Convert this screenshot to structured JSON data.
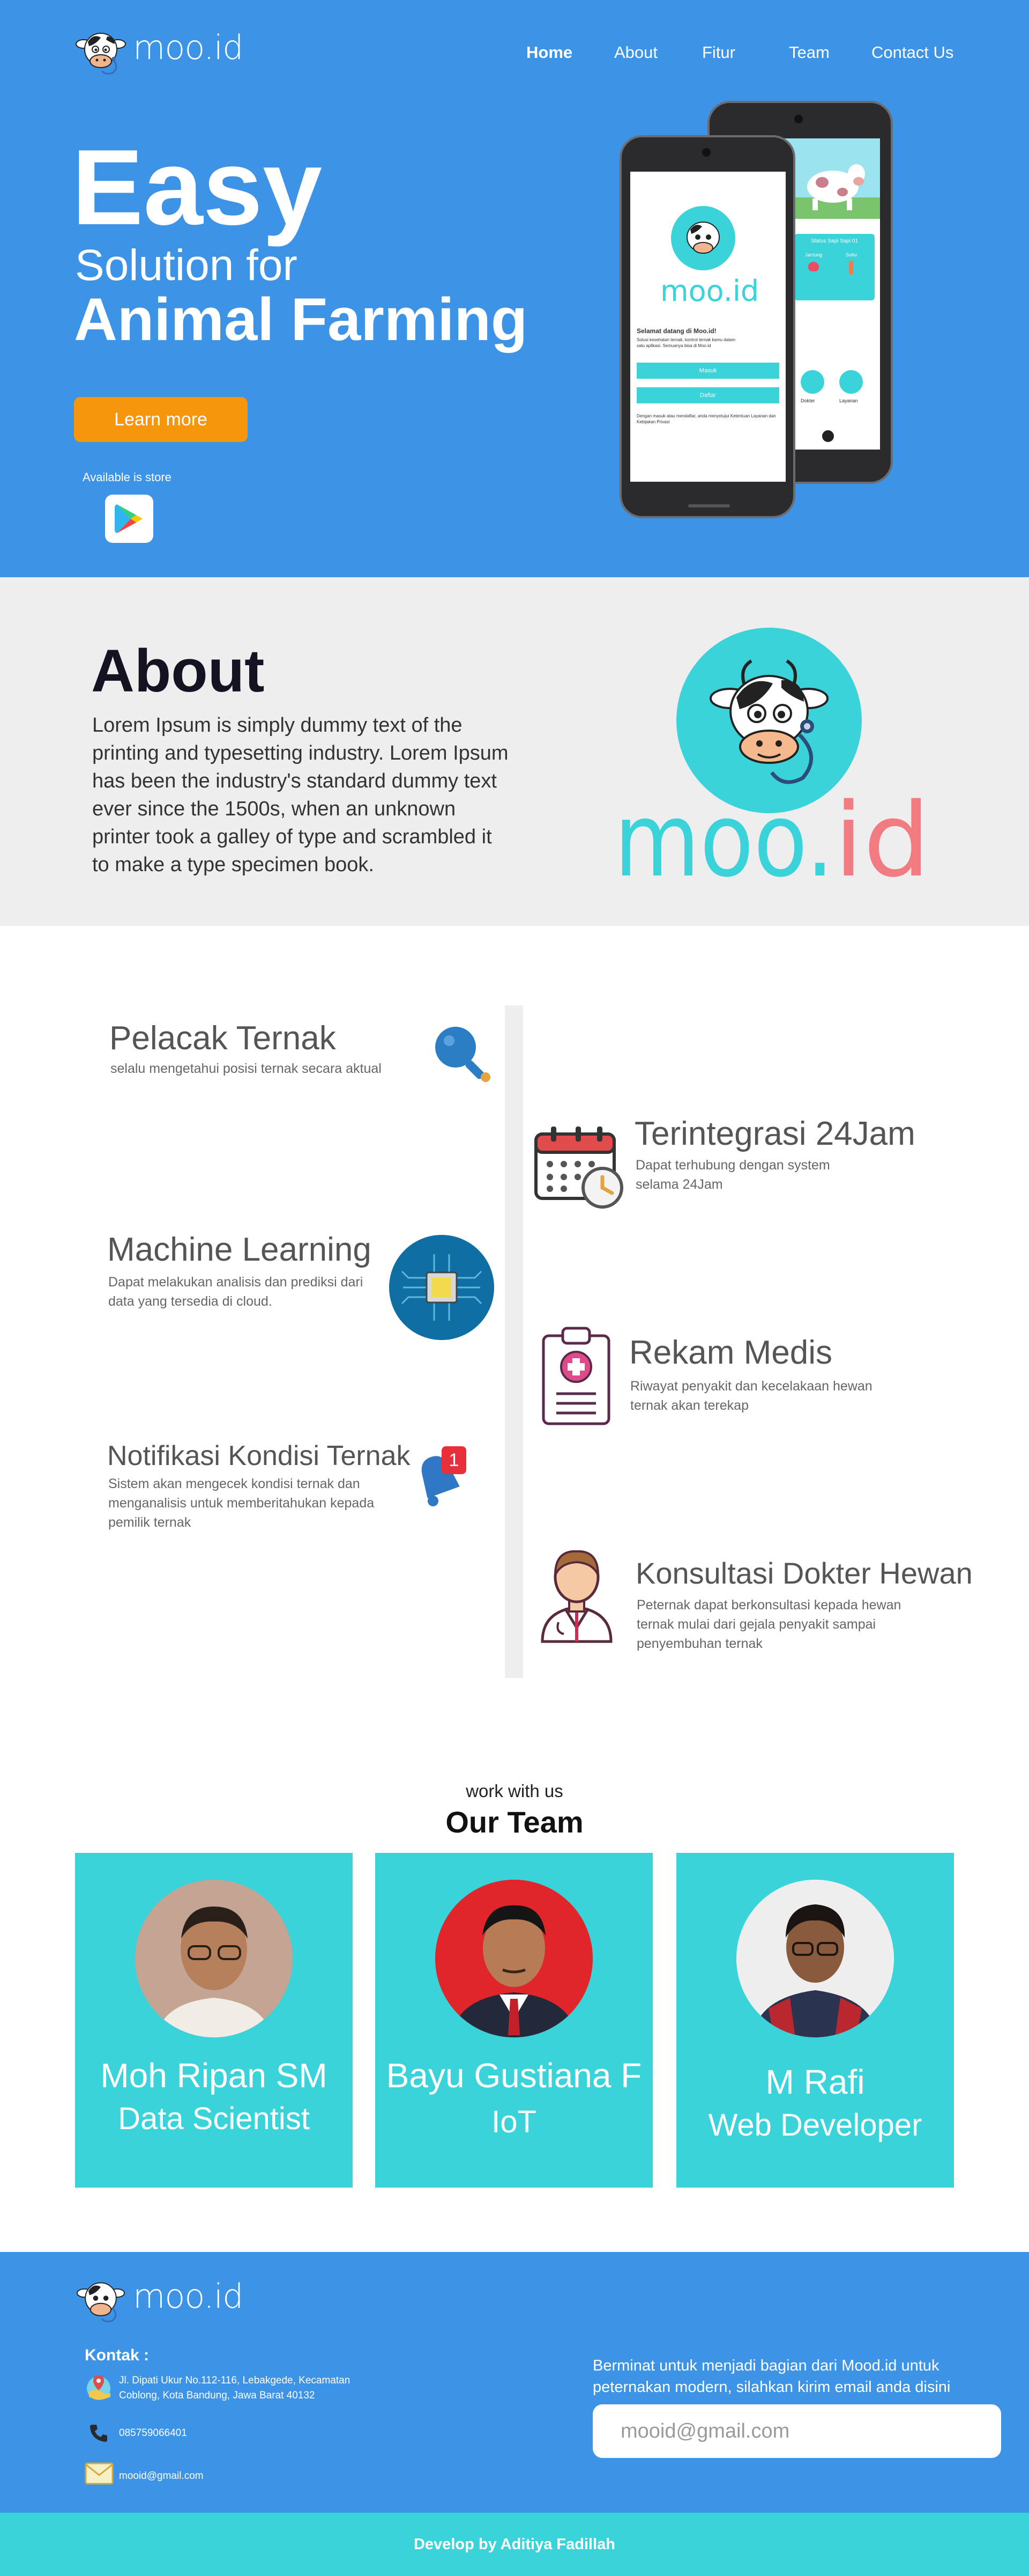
{
  "nav": {
    "logo": "moo.id",
    "items": [
      {
        "label": "Home",
        "active": true
      },
      {
        "label": "About",
        "active": false
      },
      {
        "label": "Fitur",
        "active": false
      },
      {
        "label": "Team",
        "active": false
      },
      {
        "label": "Contact Us",
        "active": false
      }
    ]
  },
  "hero": {
    "title": "Easy",
    "subtitle_1": "Solution for",
    "subtitle_2": "Animal Farming",
    "cta_label": "Learn more",
    "store_label": "Available is store",
    "store_icon": "google-play-icon"
  },
  "phone": {
    "brand": "moo.id",
    "welcome": "Selamat datang di Moo.id!",
    "intro": "Solusi kesehatan ternak, kontrol ternak kamu dalam satu aplikasi. Semuanya bisa di Moo.id",
    "btn_primary": "Masuk",
    "btn_secondary": "Daftar",
    "terms": "Dengan masuk atau mendaftar, anda menyetujui Ketentuan Layanan dan Kebijakan Privasi",
    "back_title": "Status Sapi Sapi 01",
    "back_labels": [
      "Jantung",
      "Suhu",
      "Dokter",
      "Layanan"
    ]
  },
  "about": {
    "title": "About",
    "body": "Lorem Ipsum is simply dummy text of the printing and typesetting industry. Lorem Ipsum has been the industry's standard dummy text ever since the 1500s, when an unknown printer took a galley of type and scrambled it to make a type specimen book.",
    "logo_text": "moo.id"
  },
  "features": {
    "left": [
      {
        "title": "Pelacak Ternak",
        "desc": "selalu mengetahui posisi ternak secara aktual",
        "icon": "magnifier-icon"
      },
      {
        "title": "Machine Learning",
        "desc": "Dapat melakukan analisis dan prediksi dari data yang tersedia di cloud.",
        "icon": "chip-icon"
      },
      {
        "title": "Notifikasi Kondisi Ternak",
        "desc": "Sistem akan mengecek kondisi ternak dan menganalisis untuk memberitahukan kepada pemilik ternak",
        "icon": "bell-icon",
        "badge": "1"
      }
    ],
    "right": [
      {
        "title": "Terintegrasi 24Jam",
        "desc": "Dapat terhubung dengan system selama 24Jam",
        "icon": "calendar-clock-icon"
      },
      {
        "title": "Rekam Medis",
        "desc": "Riwayat penyakit dan kecelakaan hewan ternak akan terekap",
        "icon": "clipboard-medical-icon"
      },
      {
        "title": "Konsultasi Dokter Hewan",
        "desc": "Peternak dapat berkonsultasi kepada hewan ternak mulai dari gejala penyakit sampai penyembuhan ternak",
        "icon": "doctor-icon"
      }
    ]
  },
  "team": {
    "kicker": "work with us",
    "heading": "Our Team",
    "members": [
      {
        "name": "Moh Ripan SM",
        "role": "Data Scientist",
        "avatar_bg": "#b58e7a"
      },
      {
        "name": "Bayu Gustiana F",
        "role": "IoT",
        "avatar_bg": "#e0262a"
      },
      {
        "name": "M Rafi",
        "role": "Web Developer",
        "avatar_bg": "#efefef"
      }
    ]
  },
  "footer": {
    "logo": "moo.id",
    "contact_label": "Kontak :",
    "address": "Jl. Dipati Ukur No.112-116, Lebakgede, Kecamatan Coblong, Kota Bandung, Jawa Barat 40132",
    "phone": "085759066401",
    "email": "mooid@gmail.com",
    "cta_text": "Berminat untuk menjadi bagian dari Mood.id untuk peternakan modern, silahkan kirim email anda disini",
    "email_placeholder": "mooid@gmail.com",
    "credit": "Develop by Aditiya Fadillah"
  },
  "colors": {
    "primary_blue": "#3d94e6",
    "teal": "#3ad3da",
    "orange": "#f5960d",
    "about_bg": "#eeeeee"
  }
}
